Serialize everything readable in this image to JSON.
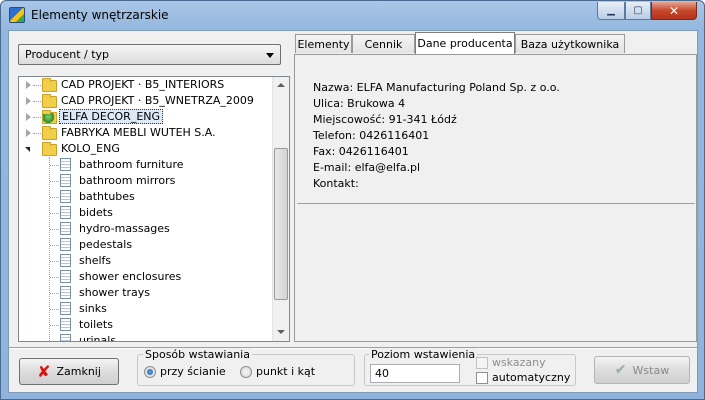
{
  "window": {
    "title": "Elementy wnętrzarskie"
  },
  "left_panel": {
    "combo_value": "Producent / typ",
    "tree": [
      {
        "label": "CAD PROJEKT · B5_INTERIORS",
        "kind": "folder",
        "state": "closed"
      },
      {
        "label": "CAD PROJEKT · B5_WNETRZA_2009",
        "kind": "folder",
        "state": "closed"
      },
      {
        "label": "ELFA DECOR_ENG",
        "kind": "folder-globe",
        "state": "closed",
        "selected": true
      },
      {
        "label": "FABRYKA MEBLI WUTEH S.A.",
        "kind": "folder",
        "state": "closed"
      },
      {
        "label": "KOLO_ENG",
        "kind": "folder",
        "state": "open"
      }
    ],
    "children": [
      "bathroom furniture",
      "bathroom mirrors",
      "bathtubes",
      "bidets",
      "hydro-massages",
      "pedestals",
      "shelfs",
      "shower enclosures",
      "shower trays",
      "sinks",
      "toilets",
      "urinals"
    ]
  },
  "tabs": [
    {
      "label": "Elementy"
    },
    {
      "label": "Cennik"
    },
    {
      "label": "Dane producenta"
    },
    {
      "label": "Baza użytkownika"
    }
  ],
  "producer": {
    "name": "Nazwa: ELFA Manufacturing Poland Sp. z o.o.",
    "street": "Ulica: Brukowa 4",
    "city": "Miejscowość: 91-341 Łódź",
    "phone": "Telefon: 0426116401",
    "fax": "Fax: 0426116401",
    "email": "E-mail: elfa@elfa.pl",
    "contact": "Kontakt:"
  },
  "bottom": {
    "close_label": "Zamknij",
    "insert_mode_title": "Sposób wstawiania",
    "mode_wall": "przy ścianie",
    "mode_point": "punkt i kąt",
    "level_title": "Poziom wstawienia",
    "level_value": "40",
    "cb_indicated": "wskazany",
    "cb_auto": "automatyczny",
    "insert_label": "Wstaw"
  },
  "colors": {
    "close_x": "#dd1111",
    "selection": "#dde9f7"
  }
}
